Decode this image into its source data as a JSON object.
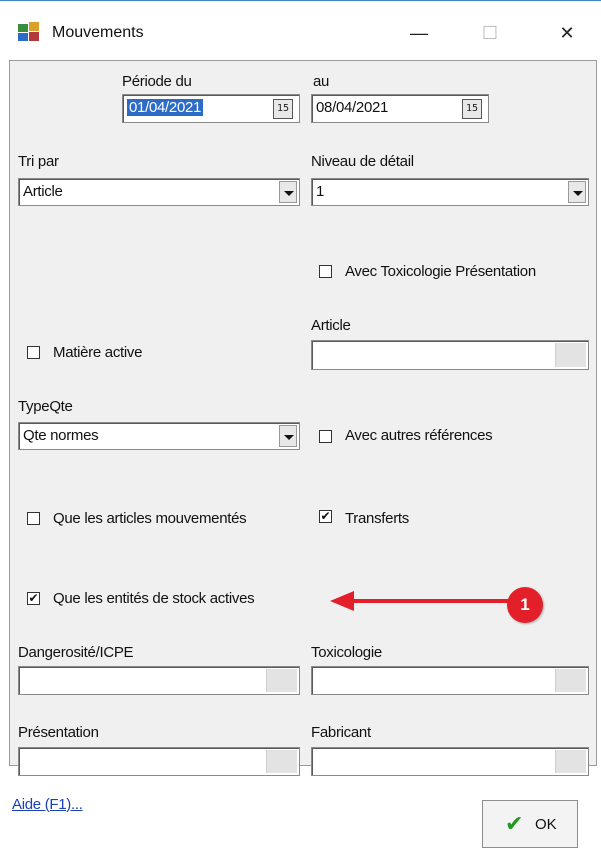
{
  "window": {
    "title": "Mouvements",
    "minimize_glyph": "—",
    "maximize_glyph": "☐",
    "close_glyph": "✕",
    "icon": "app-icon"
  },
  "period": {
    "from_label": "Période du",
    "to_label": "au",
    "from_value": "01/04/2021",
    "to_value": "08/04/2021",
    "calendar_glyph": "15"
  },
  "sort": {
    "label": "Tri par",
    "value": "Article"
  },
  "detail_level": {
    "label": "Niveau de détail",
    "value": "1"
  },
  "checkboxes": {
    "tox_presentation": {
      "label": "Avec Toxicologie  Présentation",
      "checked": false
    },
    "active_substance": {
      "label": "Matière active",
      "checked": false
    },
    "other_refs": {
      "label": "Avec autres références",
      "checked": false
    },
    "moved_articles": {
      "label": "Que les articles mouvementés",
      "checked": false
    },
    "transfers": {
      "label": "Transferts",
      "checked": true
    },
    "active_stock": {
      "label": "Que les entités de stock actives",
      "checked": true
    }
  },
  "article": {
    "label": "Article",
    "value": ""
  },
  "qty_type": {
    "label": "TypeQte",
    "value": "Qte normes"
  },
  "danger": {
    "label": "Dangerosité/ICPE",
    "value": ""
  },
  "toxicology": {
    "label": "Toxicologie",
    "value": ""
  },
  "presentation": {
    "label": "Présentation",
    "value": ""
  },
  "manufacturer": {
    "label": "Fabricant",
    "value": ""
  },
  "footer": {
    "help_link": "Aide (F1)...",
    "ok_label": "OK",
    "ok_icon": "check-icon"
  },
  "annotation": {
    "number": "1",
    "color": "#e3202a"
  }
}
